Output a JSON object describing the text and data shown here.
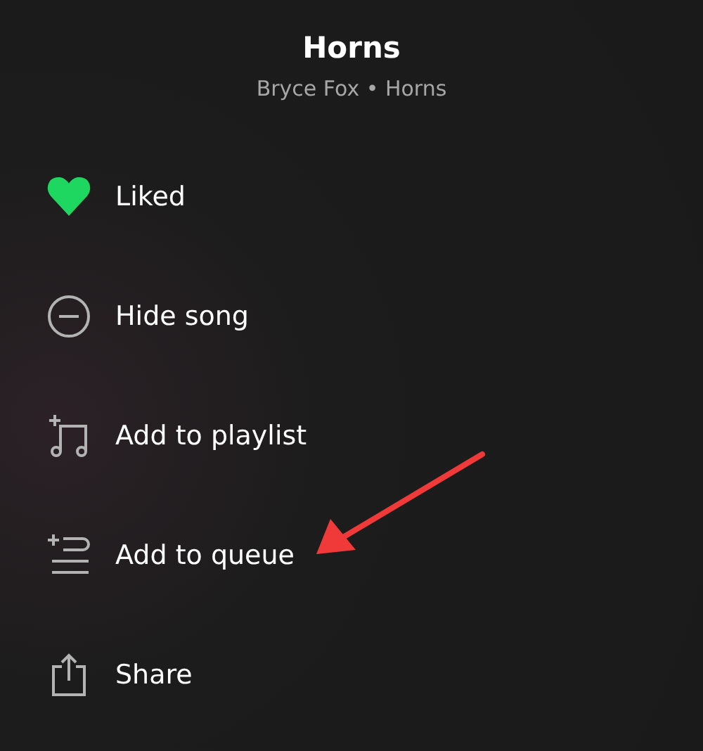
{
  "header": {
    "title": "Horns",
    "subtitle": "Bryce Fox • Horns"
  },
  "menu": [
    {
      "kind": "like",
      "label": "Liked",
      "liked": true,
      "highlighted": false
    },
    {
      "kind": "hide",
      "label": "Hide song",
      "highlighted": false
    },
    {
      "kind": "playlist",
      "label": "Add to playlist",
      "highlighted": false
    },
    {
      "kind": "queue",
      "label": "Add to queue",
      "highlighted": true
    },
    {
      "kind": "share",
      "label": "Share",
      "highlighted": false
    }
  ]
}
